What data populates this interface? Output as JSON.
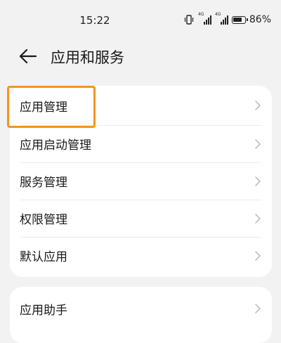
{
  "status_bar": {
    "time": "15:22",
    "battery_percent": "86%",
    "battery_level": 0.86,
    "signal_labels": [
      "4G",
      "4G"
    ]
  },
  "header": {
    "title": "应用和服务"
  },
  "menu_group_1": [
    {
      "label": "应用管理"
    },
    {
      "label": "应用启动管理"
    },
    {
      "label": "服务管理"
    },
    {
      "label": "权限管理"
    },
    {
      "label": "默认应用"
    }
  ],
  "menu_group_2": [
    {
      "label": "应用助手"
    }
  ],
  "colors": {
    "background": "#f2f2f2",
    "card": "#ffffff",
    "highlight": "#f7941d"
  }
}
